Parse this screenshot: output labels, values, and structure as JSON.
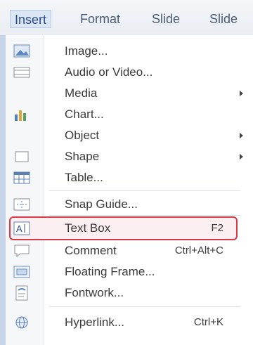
{
  "menubar": {
    "items": [
      {
        "label": "Insert"
      },
      {
        "label": "Format"
      },
      {
        "label": "Slide"
      },
      {
        "label": "Slide"
      }
    ]
  },
  "menu": {
    "items": [
      {
        "label": "Image...",
        "icon": "image-icon"
      },
      {
        "label": "Audio or Video...",
        "icon": "audio-video-icon"
      },
      {
        "label": "Media",
        "icon": "media-icon",
        "submenu": true
      },
      {
        "label": "Chart...",
        "icon": "chart-icon"
      },
      {
        "label": "Object",
        "icon": "object-icon",
        "submenu": true
      },
      {
        "label": "Shape",
        "icon": "shape-icon",
        "submenu": true
      },
      {
        "label": "Table...",
        "icon": "table-icon"
      },
      {
        "label": "Snap Guide...",
        "icon": "snap-guide-icon"
      },
      {
        "label": "Text Box",
        "icon": "text-box-icon",
        "shortcut": "F2",
        "highlighted": true
      },
      {
        "label": "Comment",
        "icon": "comment-icon",
        "shortcut": "Ctrl+Alt+C"
      },
      {
        "label": "Floating Frame...",
        "icon": "floating-frame-icon"
      },
      {
        "label": "Fontwork...",
        "icon": "fontwork-icon"
      },
      {
        "label": "Hyperlink...",
        "icon": "hyperlink-icon",
        "shortcut": "Ctrl+K"
      }
    ]
  },
  "colors": {
    "highlight_border": "#d63b45",
    "active_menu_bg": "#dbe6f5"
  }
}
